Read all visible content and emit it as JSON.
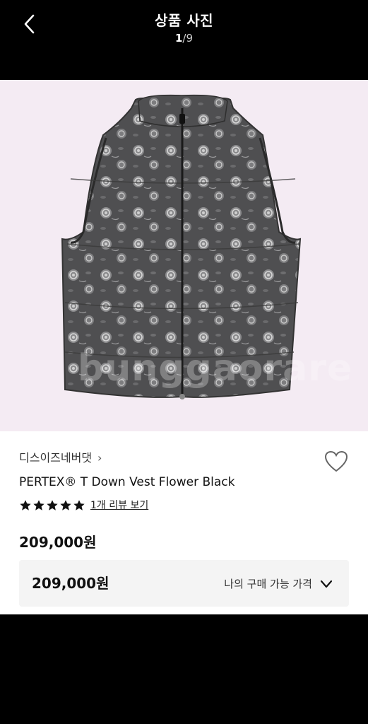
{
  "header": {
    "title": "상품 사진",
    "counter_current": "1",
    "counter_separator": "/",
    "counter_total": "9"
  },
  "photo": {
    "watermark": "bunggaorare",
    "background": "#f4ebf3"
  },
  "product": {
    "brand": "디스이즈네버댓",
    "brand_chevron": "›",
    "name": "PERTEX® T Down Vest Flower Black",
    "rating": 5,
    "review_link": "1개 리뷰 보기",
    "price": "209,000원",
    "purchase_price": "209,000원",
    "purchase_label": "나의 구매 가능 가격"
  },
  "icons": {
    "back": "back-arrow-icon",
    "favorite": "heart-icon",
    "expand": "chevron-down-icon"
  }
}
